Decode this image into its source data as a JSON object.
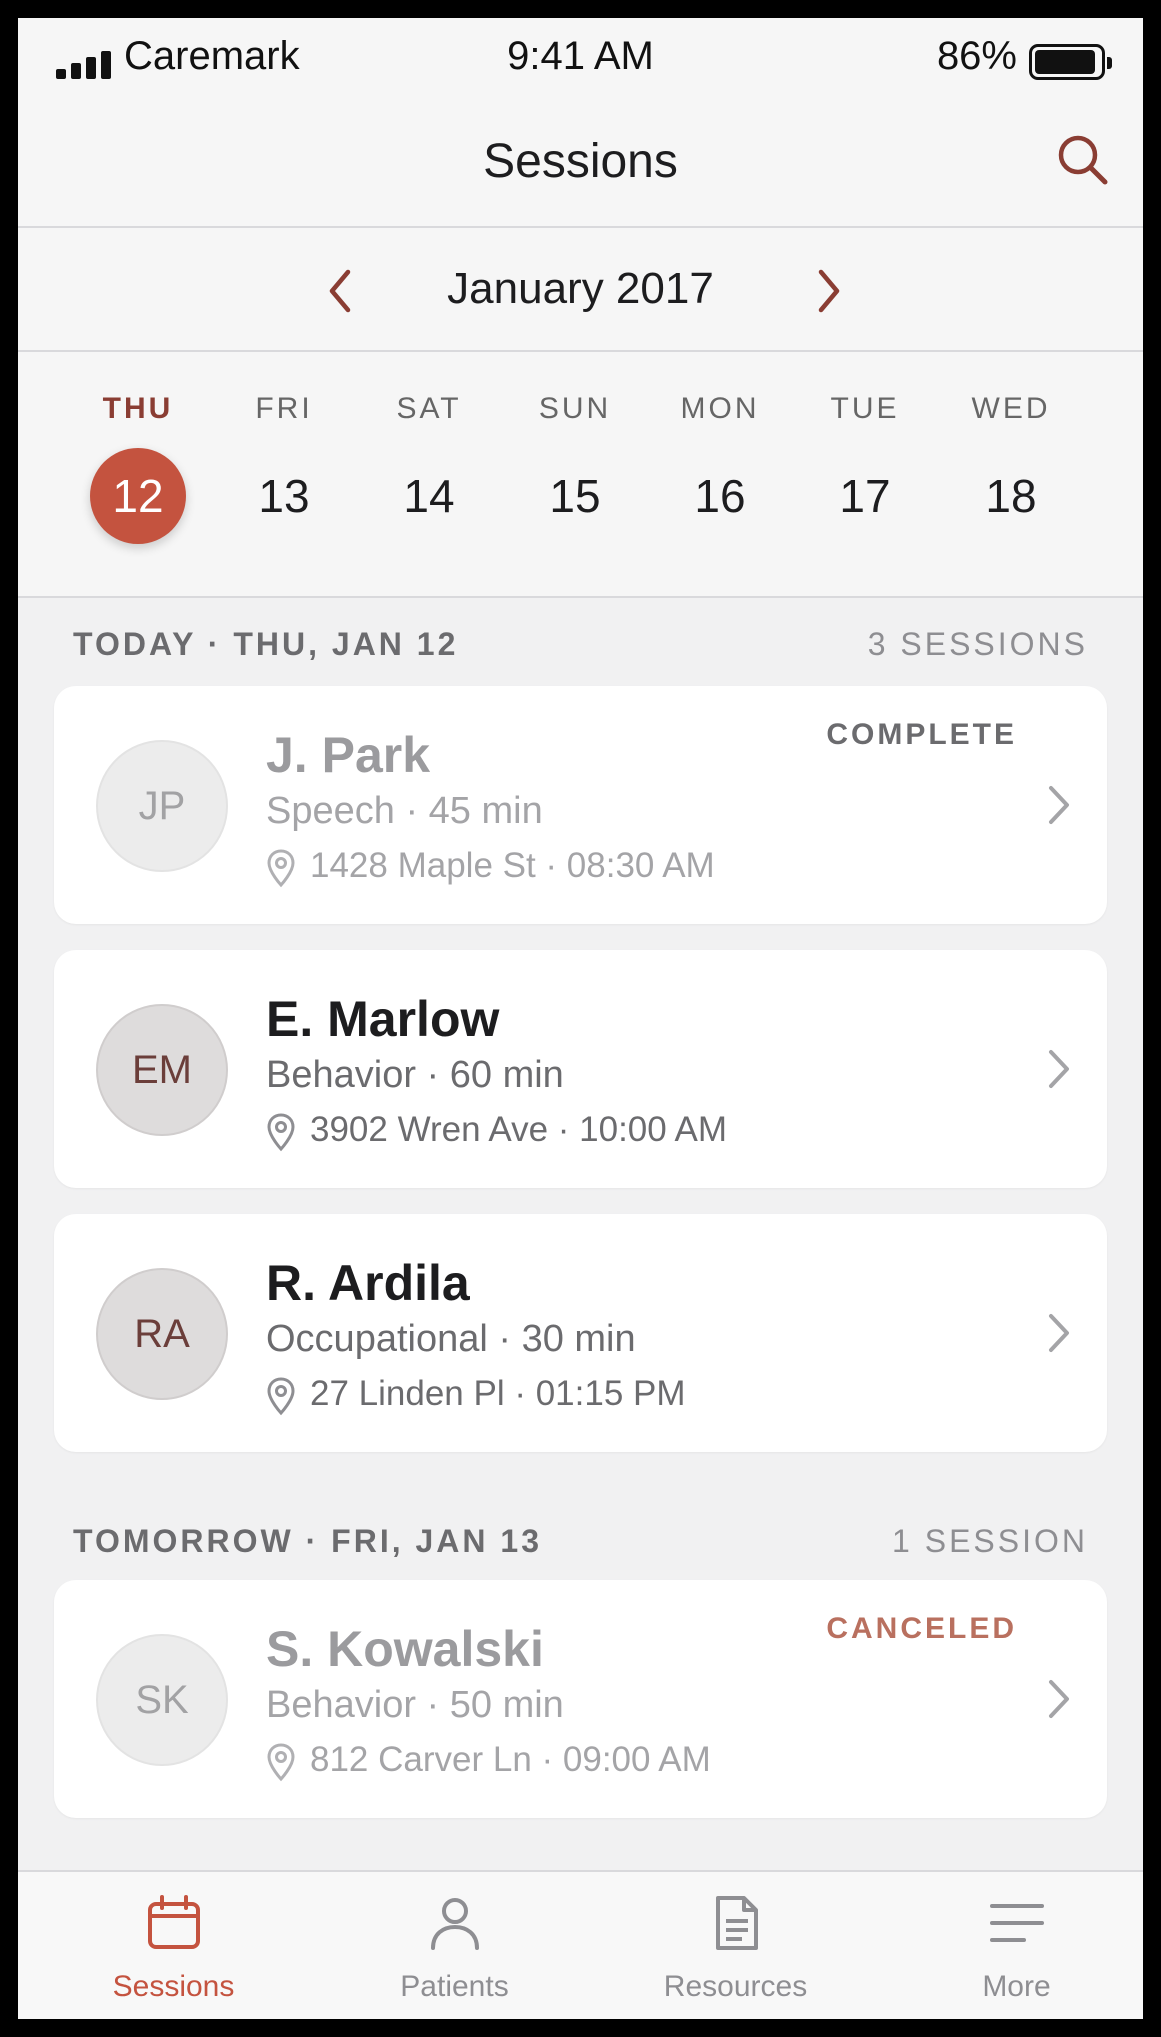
{
  "status_bar": {
    "carrier": "Caremark",
    "time": "9:41 AM",
    "battery": "86%"
  },
  "nav": {
    "title": "Sessions",
    "search_icon": "search-icon"
  },
  "calendar": {
    "month_label": "January 2017",
    "prev_icon": "chevron-left-icon",
    "next_icon": "chevron-right-icon",
    "days": [
      {
        "dow": "THU",
        "num": "12",
        "selected": true
      },
      {
        "dow": "FRI",
        "num": "13",
        "selected": false
      },
      {
        "dow": "SAT",
        "num": "14",
        "selected": false
      },
      {
        "dow": "SUN",
        "num": "15",
        "selected": false
      },
      {
        "dow": "MON",
        "num": "16",
        "selected": false
      },
      {
        "dow": "TUE",
        "num": "17",
        "selected": false
      },
      {
        "dow": "WED",
        "num": "18",
        "selected": false
      }
    ]
  },
  "sections": [
    {
      "title": "TODAY · THU, JAN 12",
      "count": "3 SESSIONS",
      "sessions": [
        {
          "initials": "JP",
          "name": "J. Park",
          "meta": "Speech · 45 min",
          "address": "1428 Maple St · 08:30 AM",
          "status": "COMPLETE"
        },
        {
          "initials": "EM",
          "name": "E. Marlow",
          "meta": "Behavior · 60 min",
          "address": "3902 Wren Ave · 10:00 AM",
          "status": ""
        },
        {
          "initials": "RA",
          "name": "R. Ardila",
          "meta": "Occupational · 30 min",
          "address": "27 Linden Pl · 01:15 PM",
          "status": ""
        }
      ]
    },
    {
      "title": "TOMORROW · FRI, JAN 13",
      "count": "1 SESSION",
      "sessions": [
        {
          "initials": "SK",
          "name": "S. Kowalski",
          "meta": "Behavior · 50 min",
          "address": "812 Carver Ln · 09:00 AM",
          "status": "CANCELED"
        }
      ]
    }
  ],
  "tab_bar": {
    "tabs": [
      {
        "label": "Sessions",
        "icon": "calendar-icon",
        "active": true
      },
      {
        "label": "Patients",
        "icon": "person-icon",
        "active": false
      },
      {
        "label": "Resources",
        "icon": "document-icon",
        "active": false
      },
      {
        "label": "More",
        "icon": "menu-icon",
        "active": false
      }
    ]
  },
  "colors": {
    "accent": "#c4533f",
    "accent_dark": "#8a3d33",
    "canceled": "#b9705f",
    "background": "#f1f1f2"
  }
}
